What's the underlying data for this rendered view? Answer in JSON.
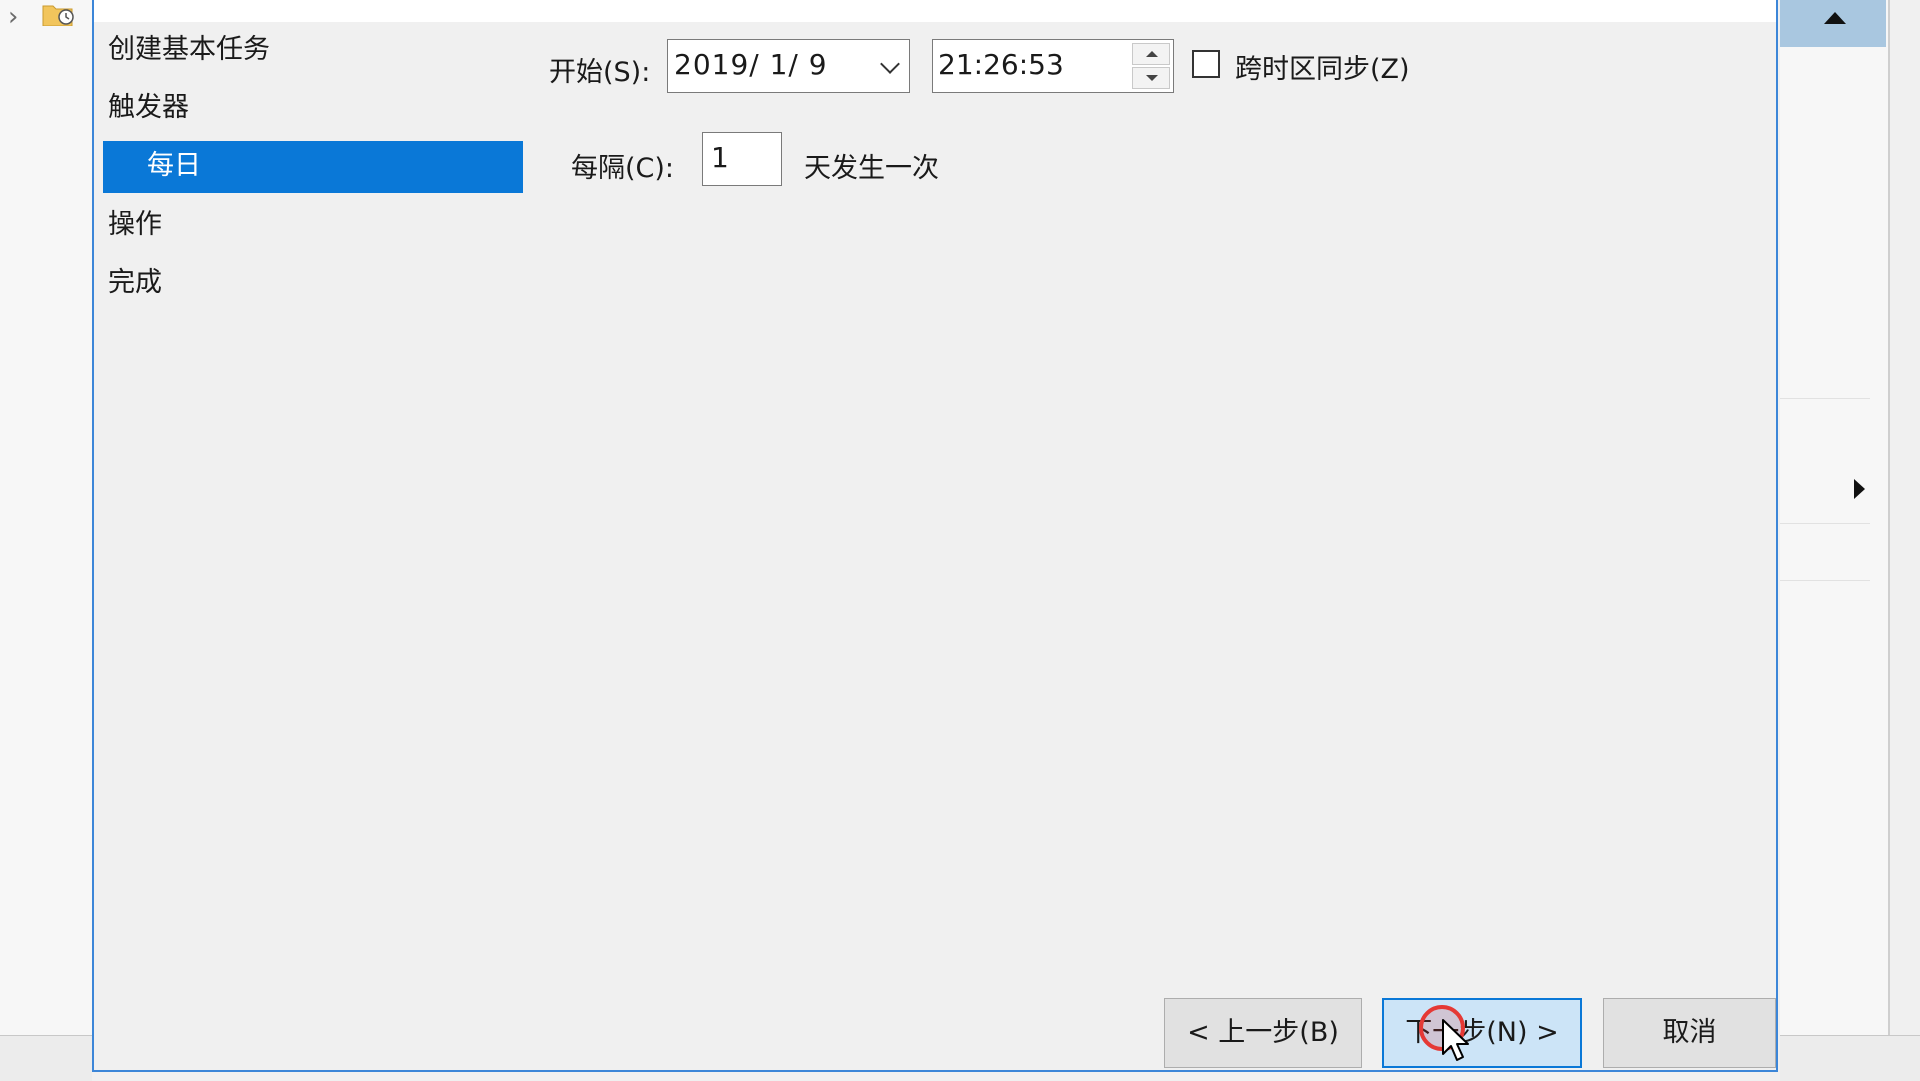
{
  "nav": {
    "items": [
      {
        "label": "创建基本任务",
        "selected": false
      },
      {
        "label": "触发器",
        "selected": false
      },
      {
        "label": "每日",
        "selected": true
      },
      {
        "label": "操作",
        "selected": false
      },
      {
        "label": "完成",
        "selected": false
      }
    ]
  },
  "trigger": {
    "start_label": "开始(S):",
    "start_date": "2019/  1/  9",
    "start_time": "21:26:53",
    "sync_timezone_label": "跨时区同步(Z)",
    "sync_timezone_checked": false,
    "interval_label": "每隔(C):",
    "interval_value": "1",
    "interval_unit": "天发生一次"
  },
  "buttons": {
    "back": "< 上一步(B)",
    "next": "下一步(N) >",
    "cancel": "取消"
  },
  "colors": {
    "selection": "#0a78d7",
    "dialog_border": "#3c86d8",
    "default_button": "#cce4f7",
    "click_indicator": "#e53935"
  },
  "icons": {
    "tree_expand": "chevron-right-icon",
    "tree_node": "task-folder-clock-icon",
    "scroll_up": "triangle-up-icon",
    "submenu": "triangle-right-icon",
    "date_dropdown": "chevron-down-icon"
  }
}
